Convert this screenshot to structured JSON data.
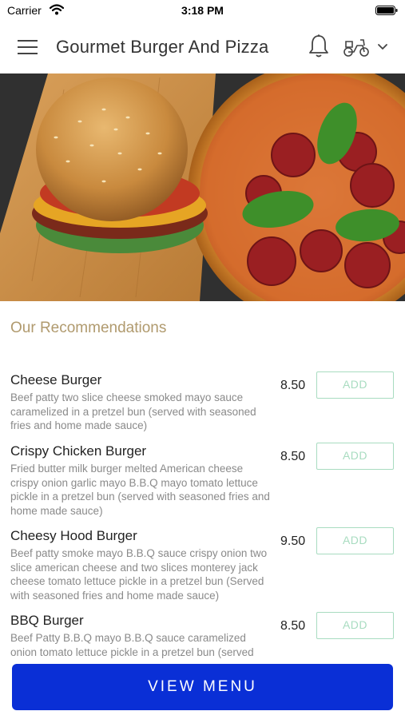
{
  "status_bar": {
    "carrier": "Carrier",
    "time": "3:18 PM"
  },
  "header": {
    "title": "Gourmet Burger And Pizza",
    "icons": [
      "menu-icon",
      "bell-icon",
      "scooter-icon",
      "chevron-down-icon"
    ]
  },
  "section_title": "Our Recommendations",
  "items": [
    {
      "name": "Cheese Burger",
      "description": "Beef patty two slice cheese smoked mayo sauce caramelized in a pretzel bun (served with seasoned fries and home made sauce)",
      "price": "8.50",
      "add_label": "ADD"
    },
    {
      "name": "Crispy Chicken Burger",
      "description": "Fried butter milk burger melted American cheese crispy onion garlic mayo B.B.Q mayo tomato lettuce pickle in a pretzel bun (served with seasoned fries and home made sauce)",
      "price": "8.50",
      "add_label": "ADD"
    },
    {
      "name": "Cheesy Hood Burger",
      "description": "Beef patty smoke mayo B.B.Q sauce crispy onion two slice american cheese and two slices monterey jack cheese tomato lettuce pickle in a pretzel bun (Served with seasoned fries and home made sauce)",
      "price": "9.50",
      "add_label": "ADD"
    },
    {
      "name": "BBQ Burger",
      "description": "Beef Patty B.B.Q mayo B.B.Q sauce caramelized onion tomato lettuce pickle in a pretzel bun (served",
      "price": "8.50",
      "add_label": "ADD"
    }
  ],
  "view_menu_label": "VIEW MENU",
  "colors": {
    "accent_button": "#0a2fd6",
    "add_button": "#a8dcc0",
    "section_title": "#b09a6e"
  }
}
